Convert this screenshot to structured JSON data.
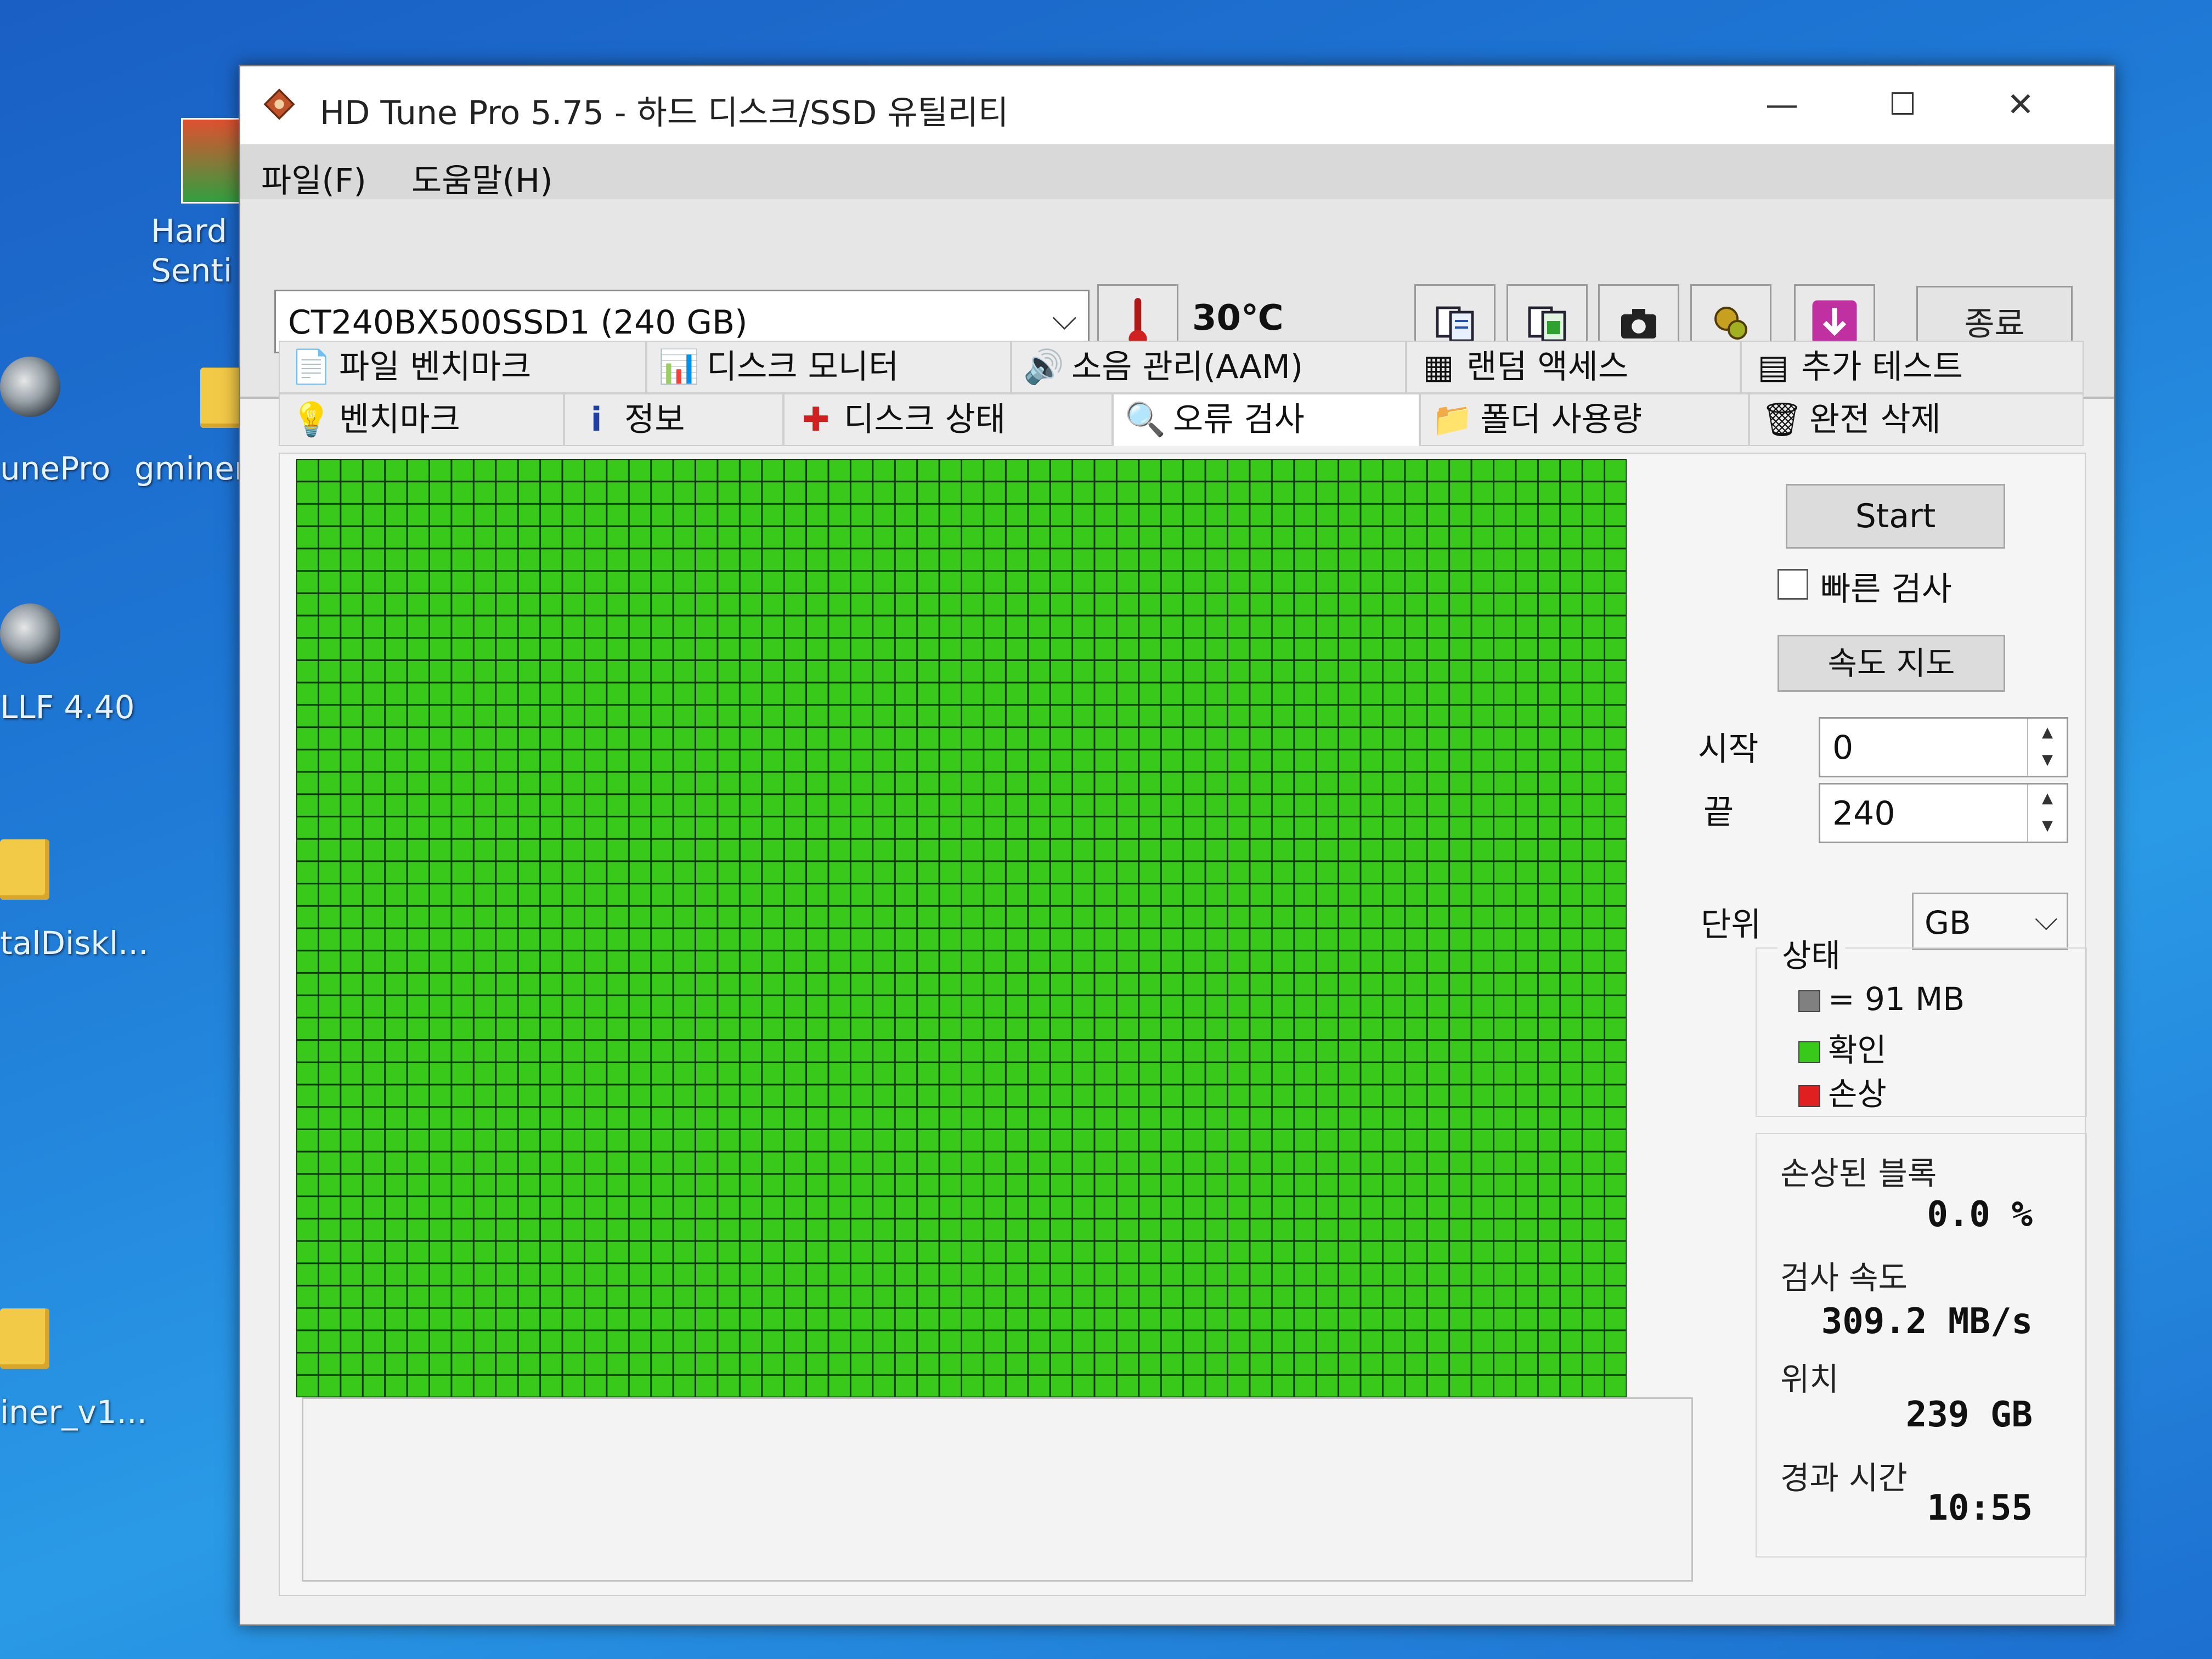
{
  "desktop": {
    "icons": [
      {
        "label": "Hard\nSenti"
      },
      {
        "label": "unePro"
      },
      {
        "label": "gminer"
      },
      {
        "label": "LLF 4.40"
      },
      {
        "label": "talDiskl..."
      },
      {
        "label": "iner_v1..."
      }
    ]
  },
  "window": {
    "title": "HD Tune Pro 5.75 - 하드 디스크/SSD 유틸리티",
    "controls": {
      "minimize": "—",
      "maximize": "☐",
      "close": "✕"
    }
  },
  "menu": {
    "file": "파일(F)",
    "help": "도움말(H)"
  },
  "toolbar": {
    "drive": "CT240BX500SSD1 (240 GB)",
    "temperature": "30℃",
    "exit_label": "종료",
    "icons": [
      "copy-info-icon",
      "copy-screenshot-icon",
      "camera-icon",
      "options-icon",
      "save-icon"
    ]
  },
  "tabs": {
    "row1": [
      "파일 벤치마크",
      "디스크 모니터",
      "소음 관리(AAM)",
      "랜덤 액세스",
      "추가 테스트"
    ],
    "row2": [
      "벤치마크",
      "정보",
      "디스크 상태",
      "오류 검사",
      "폴더 사용량",
      "완전 삭제"
    ],
    "active": "오류 검사"
  },
  "error_scan": {
    "start_label": "Start",
    "quick_scan_label": "빠른 검사",
    "quick_scan_checked": false,
    "speed_map_label": "속도 지도",
    "start_field_label": "시작",
    "start_value": "0",
    "end_field_label": "끝",
    "end_value": "240",
    "unit_label": "단위",
    "unit_value": "GB",
    "status_title": "상태",
    "legend": {
      "block_size": "= 91 MB",
      "ok": "확인",
      "damaged": "손상"
    },
    "colors": {
      "ok": "#39c91a",
      "damaged": "#e02020",
      "block": "#808080",
      "grid_line": "#0b3a06"
    },
    "damaged_blocks_label": "손상된 블록",
    "damaged_blocks_value": "0.0 %",
    "scan_speed_label": "검사 속도",
    "scan_speed_value": "309.2 MB/s",
    "position_label": "위치",
    "position_value": "239 GB",
    "elapsed_label": "경과 시간",
    "elapsed_value": "10:55",
    "map": {
      "columns": 60,
      "rows": 42
    }
  }
}
